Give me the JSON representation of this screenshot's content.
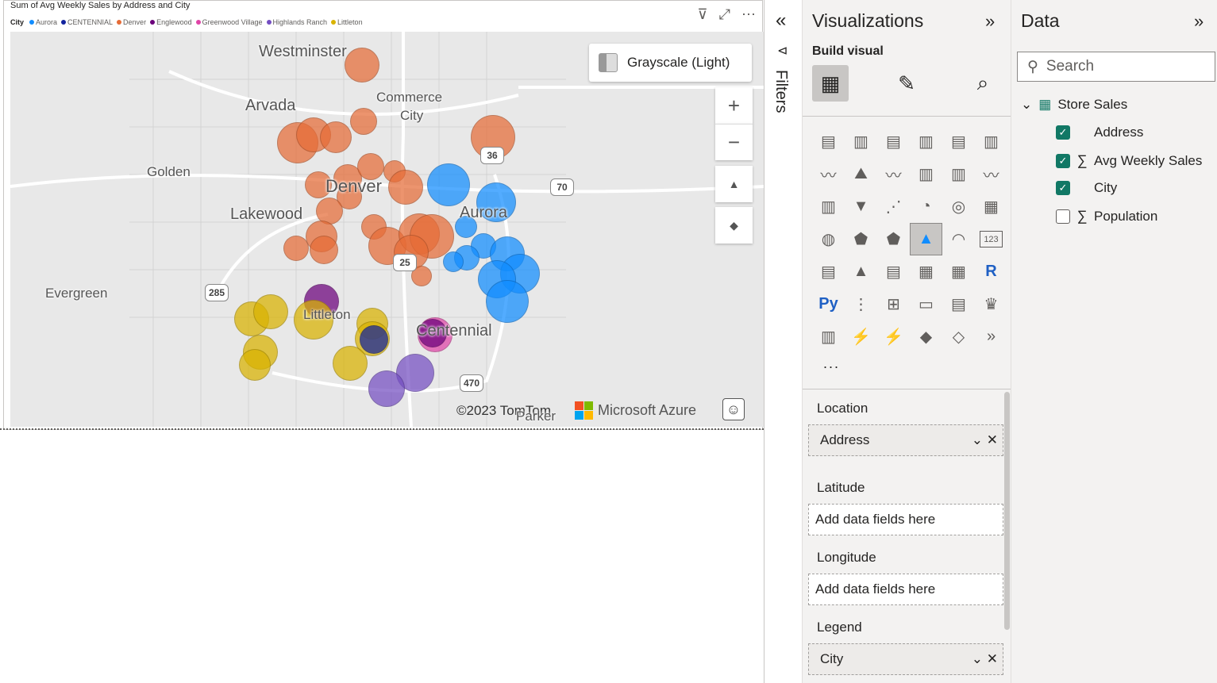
{
  "visual": {
    "title": "Sum of Avg Weekly Sales by Address and City",
    "legend_title": "City",
    "legend": [
      {
        "name": "Aurora",
        "color": "#118dff"
      },
      {
        "name": "CENTENNIAL",
        "color": "#12239e"
      },
      {
        "name": "Denver",
        "color": "#e66c37"
      },
      {
        "name": "Englewood",
        "color": "#6b007b"
      },
      {
        "name": "Greenwood Village",
        "color": "#e044a7"
      },
      {
        "name": "Highlands Ranch",
        "color": "#744ec2"
      },
      {
        "name": "Littleton",
        "color": "#d9b300"
      }
    ],
    "header_icons": [
      "filter-icon",
      "focus-mode-icon",
      "more-options-icon"
    ]
  },
  "map": {
    "style_label": "Grayscale (Light)",
    "zoom_in": "+",
    "zoom_out": "−",
    "tilt": "▲",
    "compass": "◆",
    "copyright": "©2023 TomTom",
    "provider": "Microsoft Azure",
    "places": [
      {
        "name": "Westminster"
      },
      {
        "name": "Arvada"
      },
      {
        "name": "Commerce"
      },
      {
        "name": "City"
      },
      {
        "name": "Golden"
      },
      {
        "name": "Denver"
      },
      {
        "name": "Aurora"
      },
      {
        "name": "Lakewood"
      },
      {
        "name": "Evergreen"
      },
      {
        "name": "Littleton"
      },
      {
        "name": "Centennial"
      },
      {
        "name": "Parker"
      }
    ],
    "highways": [
      "36",
      "70",
      "25",
      "285",
      "470"
    ]
  },
  "filters": {
    "label": "Filters"
  },
  "visualizations": {
    "title": "Visualizations",
    "build_label": "Build visual",
    "more": "...",
    "wells": [
      {
        "label": "Location",
        "field": "Address",
        "placeholder": ""
      },
      {
        "label": "Latitude",
        "field": "",
        "placeholder": "Add data fields here"
      },
      {
        "label": "Longitude",
        "field": "",
        "placeholder": "Add data fields here"
      },
      {
        "label": "Legend",
        "field": "City",
        "placeholder": ""
      }
    ],
    "grid_icons": [
      "▤",
      "▥",
      "▤",
      "▥",
      "▤",
      "▥",
      "〰",
      "⛰",
      "〰",
      "▥",
      "▥",
      "〰",
      "▥",
      "▼",
      "⋰",
      "◔",
      "◎",
      "▦",
      "◍",
      "⬟",
      "⬟",
      "▲",
      "◠",
      "123",
      "▤",
      "▲",
      "▤",
      "▦",
      "▦",
      "R",
      "Py",
      "⋮",
      "⊞",
      "▭",
      "▤",
      "♛",
      "▥",
      "⚡",
      "⚡",
      "◆",
      "◇",
      "»"
    ]
  },
  "data_pane": {
    "title": "Data",
    "search_placeholder": "Search",
    "table": "Store Sales",
    "fields": [
      {
        "name": "Address",
        "checked": true,
        "sigma": false
      },
      {
        "name": "Avg Weekly Sales",
        "checked": true,
        "sigma": true
      },
      {
        "name": "City",
        "checked": true,
        "sigma": false
      },
      {
        "name": "Population",
        "checked": false,
        "sigma": true
      }
    ]
  }
}
